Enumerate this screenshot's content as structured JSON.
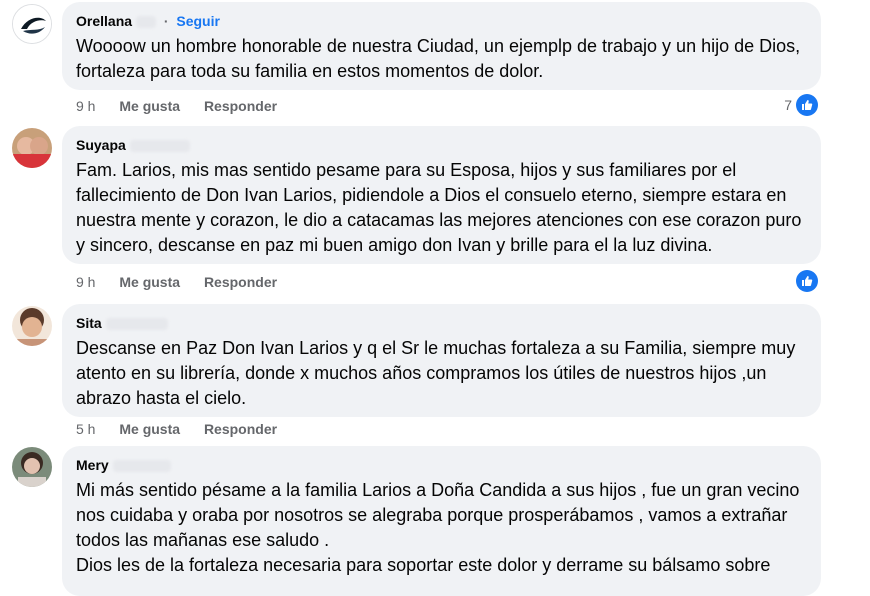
{
  "comments": [
    {
      "author": "Orellana",
      "follow_label": "Seguir",
      "dot": "·",
      "text": "Woooow un hombre honorable de nuestra Ciudad, un ejemplp de trabajo y un hijo de Dios, fortaleza para toda su familia en estos momentos de dolor.",
      "time": "9 h",
      "like_label": "Me gusta",
      "reply_label": "Responder",
      "reaction_count": "7",
      "avatar_colors": [
        "#0e1a24",
        "#3a5a78"
      ]
    },
    {
      "author": "Suyapa",
      "text": "Fam. Larios, mis mas sentido pesame para su Esposa, hijos y sus familiares por el fallecimiento de Don Ivan Larios, pidiendole a Dios el consuelo eterno, siempre estara en nuestra mente y corazon, le dio a catacamas las mejores atenciones con ese corazon puro y sincero, descanse en paz mi buen amigo don Ivan y brille para el la luz divina.",
      "time": "9 h",
      "like_label": "Me gusta",
      "reply_label": "Responder",
      "avatar_colors": [
        "#c8a07a",
        "#d8343a"
      ]
    },
    {
      "author": "Sita",
      "text": "Descanse en Paz Don Ivan Larios y q el Sr le muchas fortaleza a su Familia, siempre muy atento en su librería, donde x muchos años compramos los útiles de nuestros hijos ,un abrazo hasta el cielo.",
      "time": "5 h",
      "like_label": "Me gusta",
      "reply_label": "Responder",
      "avatar_colors": [
        "#d9a98a",
        "#6b4a3a"
      ]
    },
    {
      "author": "Mery",
      "text": "Mi más sentido pésame a la familia Larios a Doña Candida a sus hijos , fue un gran vecino nos cuidaba y oraba por nosotros se alegraba porque prosperábamos , vamos a extrañar todos las mañanas ese saludo .",
      "text2": "Dios les de la fortaleza necesaria para soportar este dolor y derrame su bálsamo sobre",
      "avatar_colors": [
        "#7b8b7a",
        "#e2c2b0"
      ]
    }
  ],
  "colors": {
    "bubble": "#f0f2f5",
    "link": "#1877f2",
    "secondary_text": "#65676b"
  },
  "icons": [
    "like-thumb-icon"
  ]
}
